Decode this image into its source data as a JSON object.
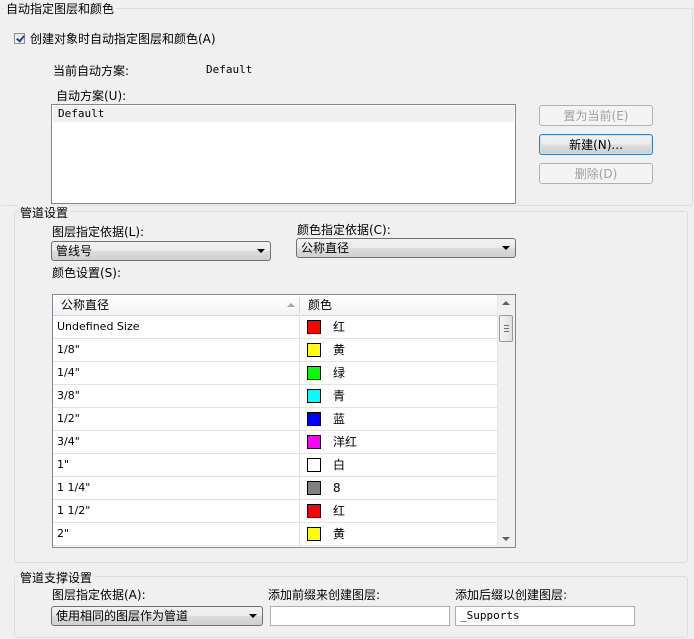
{
  "auto_section": {
    "title": "自动指定图层和颜色",
    "checkbox_label": "创建对象时自动指定图层和颜色(A)",
    "checkbox_checked": true,
    "current_scheme_label": "当前自动方案:",
    "current_scheme_value": "Default",
    "schemes_label": "自动方案(U):",
    "schemes": [
      "Default"
    ],
    "set_current_button": "置为当前(E)",
    "new_button": "新建(N)...",
    "delete_button": "删除(D)"
  },
  "pipe_settings": {
    "title": "管道设置",
    "layer_basis_label": "图层指定依据(L):",
    "layer_basis_value": "管线号",
    "color_basis_label": "颜色指定依据(C):",
    "color_basis_value": "公称直径",
    "color_settings_label": "颜色设置(S):",
    "grid": {
      "columns": [
        "公称直径",
        "颜色"
      ],
      "rows": [
        {
          "size": "Undefined Size",
          "color_name": "红",
          "color": "#ff0000"
        },
        {
          "size": "1/8\"",
          "color_name": "黄",
          "color": "#ffff00"
        },
        {
          "size": "1/4\"",
          "color_name": "绿",
          "color": "#00ff00"
        },
        {
          "size": "3/8\"",
          "color_name": "青",
          "color": "#00ffff"
        },
        {
          "size": "1/2\"",
          "color_name": "蓝",
          "color": "#0000ff"
        },
        {
          "size": "3/4\"",
          "color_name": "洋红",
          "color": "#ff00ff"
        },
        {
          "size": "1\"",
          "color_name": "白",
          "color": "#ffffff"
        },
        {
          "size": "1 1/4\"",
          "color_name": "8",
          "color": "#808080"
        },
        {
          "size": "1 1/2\"",
          "color_name": "红",
          "color": "#ff0000"
        },
        {
          "size": "2\"",
          "color_name": "黄",
          "color": "#ffff00"
        }
      ]
    }
  },
  "support_settings": {
    "title": "管道支撑设置",
    "layer_basis_label": "图层指定依据(A):",
    "layer_basis_value": "使用相同的图层作为管道",
    "prefix_label": "添加前缀来创建图层:",
    "prefix_value": "",
    "suffix_label": "添加后缀以创建图层:",
    "suffix_value": "_Supports"
  }
}
